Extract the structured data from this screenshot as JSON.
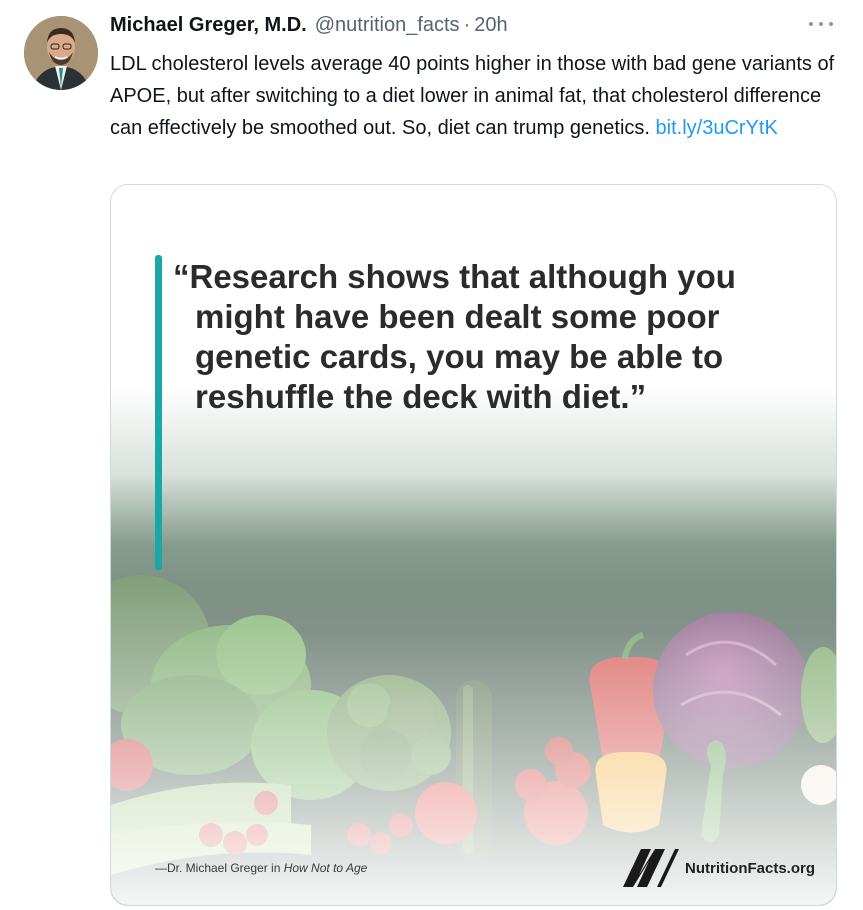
{
  "tweet": {
    "author_name": "Michael Greger, M.D.",
    "handle": "@nutrition_facts",
    "separator": "·",
    "time": "20h",
    "text": "LDL cholesterol levels average 40 points higher in those with bad gene variants of APOE, but after switching to a diet lower in animal fat, that cholesterol difference can effectively be smoothed out. So, diet can trump genetics.",
    "link": "bit.ly/3uCrYtK",
    "more_icon": "ellipsis-icon",
    "avatar_icon": "avatar"
  },
  "media": {
    "quote": "“Research shows that although you might have been dealt some poor genetic cards, you may be able to reshuffle the deck with diet.”",
    "attribution_prefix": "—Dr. Michael Greger in ",
    "attribution_book": "How Not to Age",
    "brand_name": "NutritionFacts.org",
    "brand_icon": "nutritionfacts-logo-icon",
    "colors": {
      "accent_bar": "#1aa7a7",
      "background_green": "#1c3a2a"
    }
  }
}
